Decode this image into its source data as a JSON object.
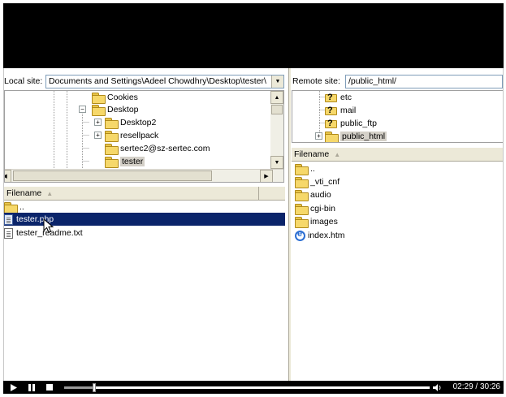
{
  "local": {
    "site_label": "Local site:",
    "site_path": "Documents and Settings\\Adeel Chowdhry\\Desktop\\tester\\",
    "tree": {
      "cookies": "Cookies",
      "desktop": "Desktop",
      "desktop2": "Desktop2",
      "resellpack": "resellpack",
      "sertec": "sertec2@sz-sertec.com",
      "tester": "tester"
    },
    "list_header": "Filename",
    "files": [
      {
        "name": "..",
        "kind": "parent-folder"
      },
      {
        "name": "tester.php",
        "kind": "php-file",
        "selected": true
      },
      {
        "name": "tester_readme.txt",
        "kind": "text-file"
      }
    ]
  },
  "remote": {
    "site_label": "Remote site:",
    "site_path": "/public_html/",
    "tree": {
      "etc": "etc",
      "mail": "mail",
      "public_ftp": "public_ftp",
      "public_html": "public_html"
    },
    "list_header": "Filename",
    "files": [
      {
        "name": "..",
        "kind": "parent-folder"
      },
      {
        "name": "_vti_cnf",
        "kind": "folder"
      },
      {
        "name": "audio",
        "kind": "folder"
      },
      {
        "name": "cgi-bin",
        "kind": "folder"
      },
      {
        "name": "images",
        "kind": "folder"
      },
      {
        "name": "index.htm",
        "kind": "html-file"
      }
    ]
  },
  "player": {
    "current_time": "02:29",
    "total_time": "30:26",
    "time_display": "02:29 / 30:26",
    "progress_fraction": 0.082,
    "volume_fraction": 1.0
  }
}
